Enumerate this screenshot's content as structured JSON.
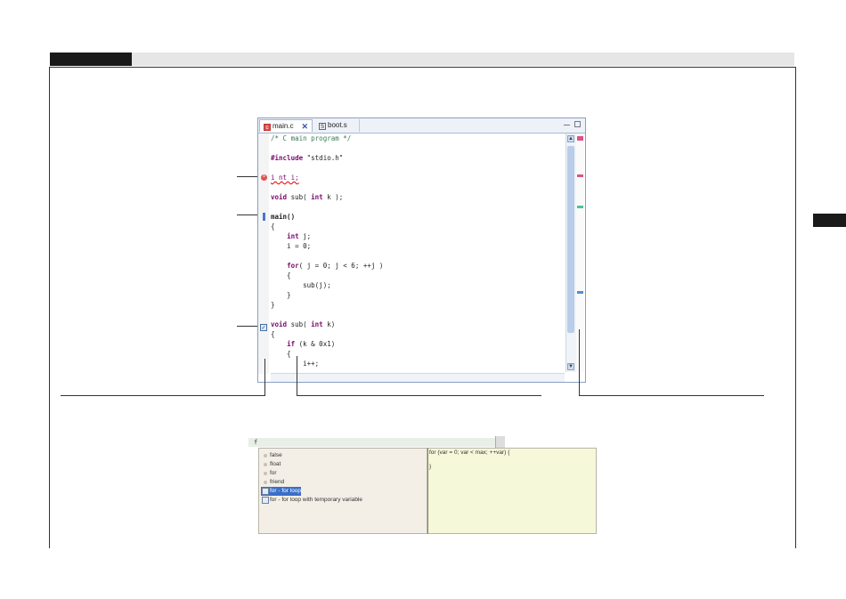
{
  "editor": {
    "tabs": [
      {
        "label": "main.c",
        "icon": "c-file-icon",
        "active": true
      },
      {
        "label": "boot.s",
        "icon": "s-file-icon",
        "active": false
      }
    ],
    "code_lines": [
      {
        "text": "/* C main program */"
      },
      {
        "text": ""
      },
      {
        "text": "#include \"stdio.h\""
      },
      {
        "text": ""
      },
      {
        "text": "i nt i;"
      },
      {
        "text": ""
      },
      {
        "text": "void sub( int k );"
      },
      {
        "text": ""
      },
      {
        "text": "main()"
      },
      {
        "text": "{"
      },
      {
        "text": "    int j;"
      },
      {
        "text": "    i = 0;"
      },
      {
        "text": ""
      },
      {
        "text": "    for( j = 0; j < 6; ++j )"
      },
      {
        "text": "    {"
      },
      {
        "text": "        sub(j);"
      },
      {
        "text": "    }"
      },
      {
        "text": "}"
      },
      {
        "text": ""
      },
      {
        "text": "void sub( int k)"
      },
      {
        "text": "{"
      },
      {
        "text": "    if (k & 0x1)"
      },
      {
        "text": "    {"
      },
      {
        "text": "        i++;"
      }
    ],
    "markers": {
      "error_icon": "error-icon",
      "bookmark_icon": "bookmark-icon",
      "task_icon": "task-icon"
    },
    "colors": {
      "keyword": "#7a0a6e",
      "comment": "#3a7a5a",
      "error": "#d00000",
      "overview_error": "#e0508a",
      "overview_task": "#50c0a0",
      "overview_bookmark": "#5090d0"
    }
  },
  "autocomplete": {
    "typed": "f",
    "items": [
      {
        "label": "false",
        "kind": "keyword",
        "selected": false
      },
      {
        "label": "float",
        "kind": "keyword",
        "selected": false
      },
      {
        "label": "for",
        "kind": "keyword",
        "selected": false
      },
      {
        "label": "friend",
        "kind": "keyword",
        "selected": false
      },
      {
        "label": "for - for loop",
        "kind": "template",
        "selected": true
      },
      {
        "label": "for - for loop with temporary variable",
        "kind": "template",
        "selected": false
      }
    ],
    "preview_lines": [
      "for (var = 0; var < max; ++var) {",
      "",
      "}"
    ]
  }
}
